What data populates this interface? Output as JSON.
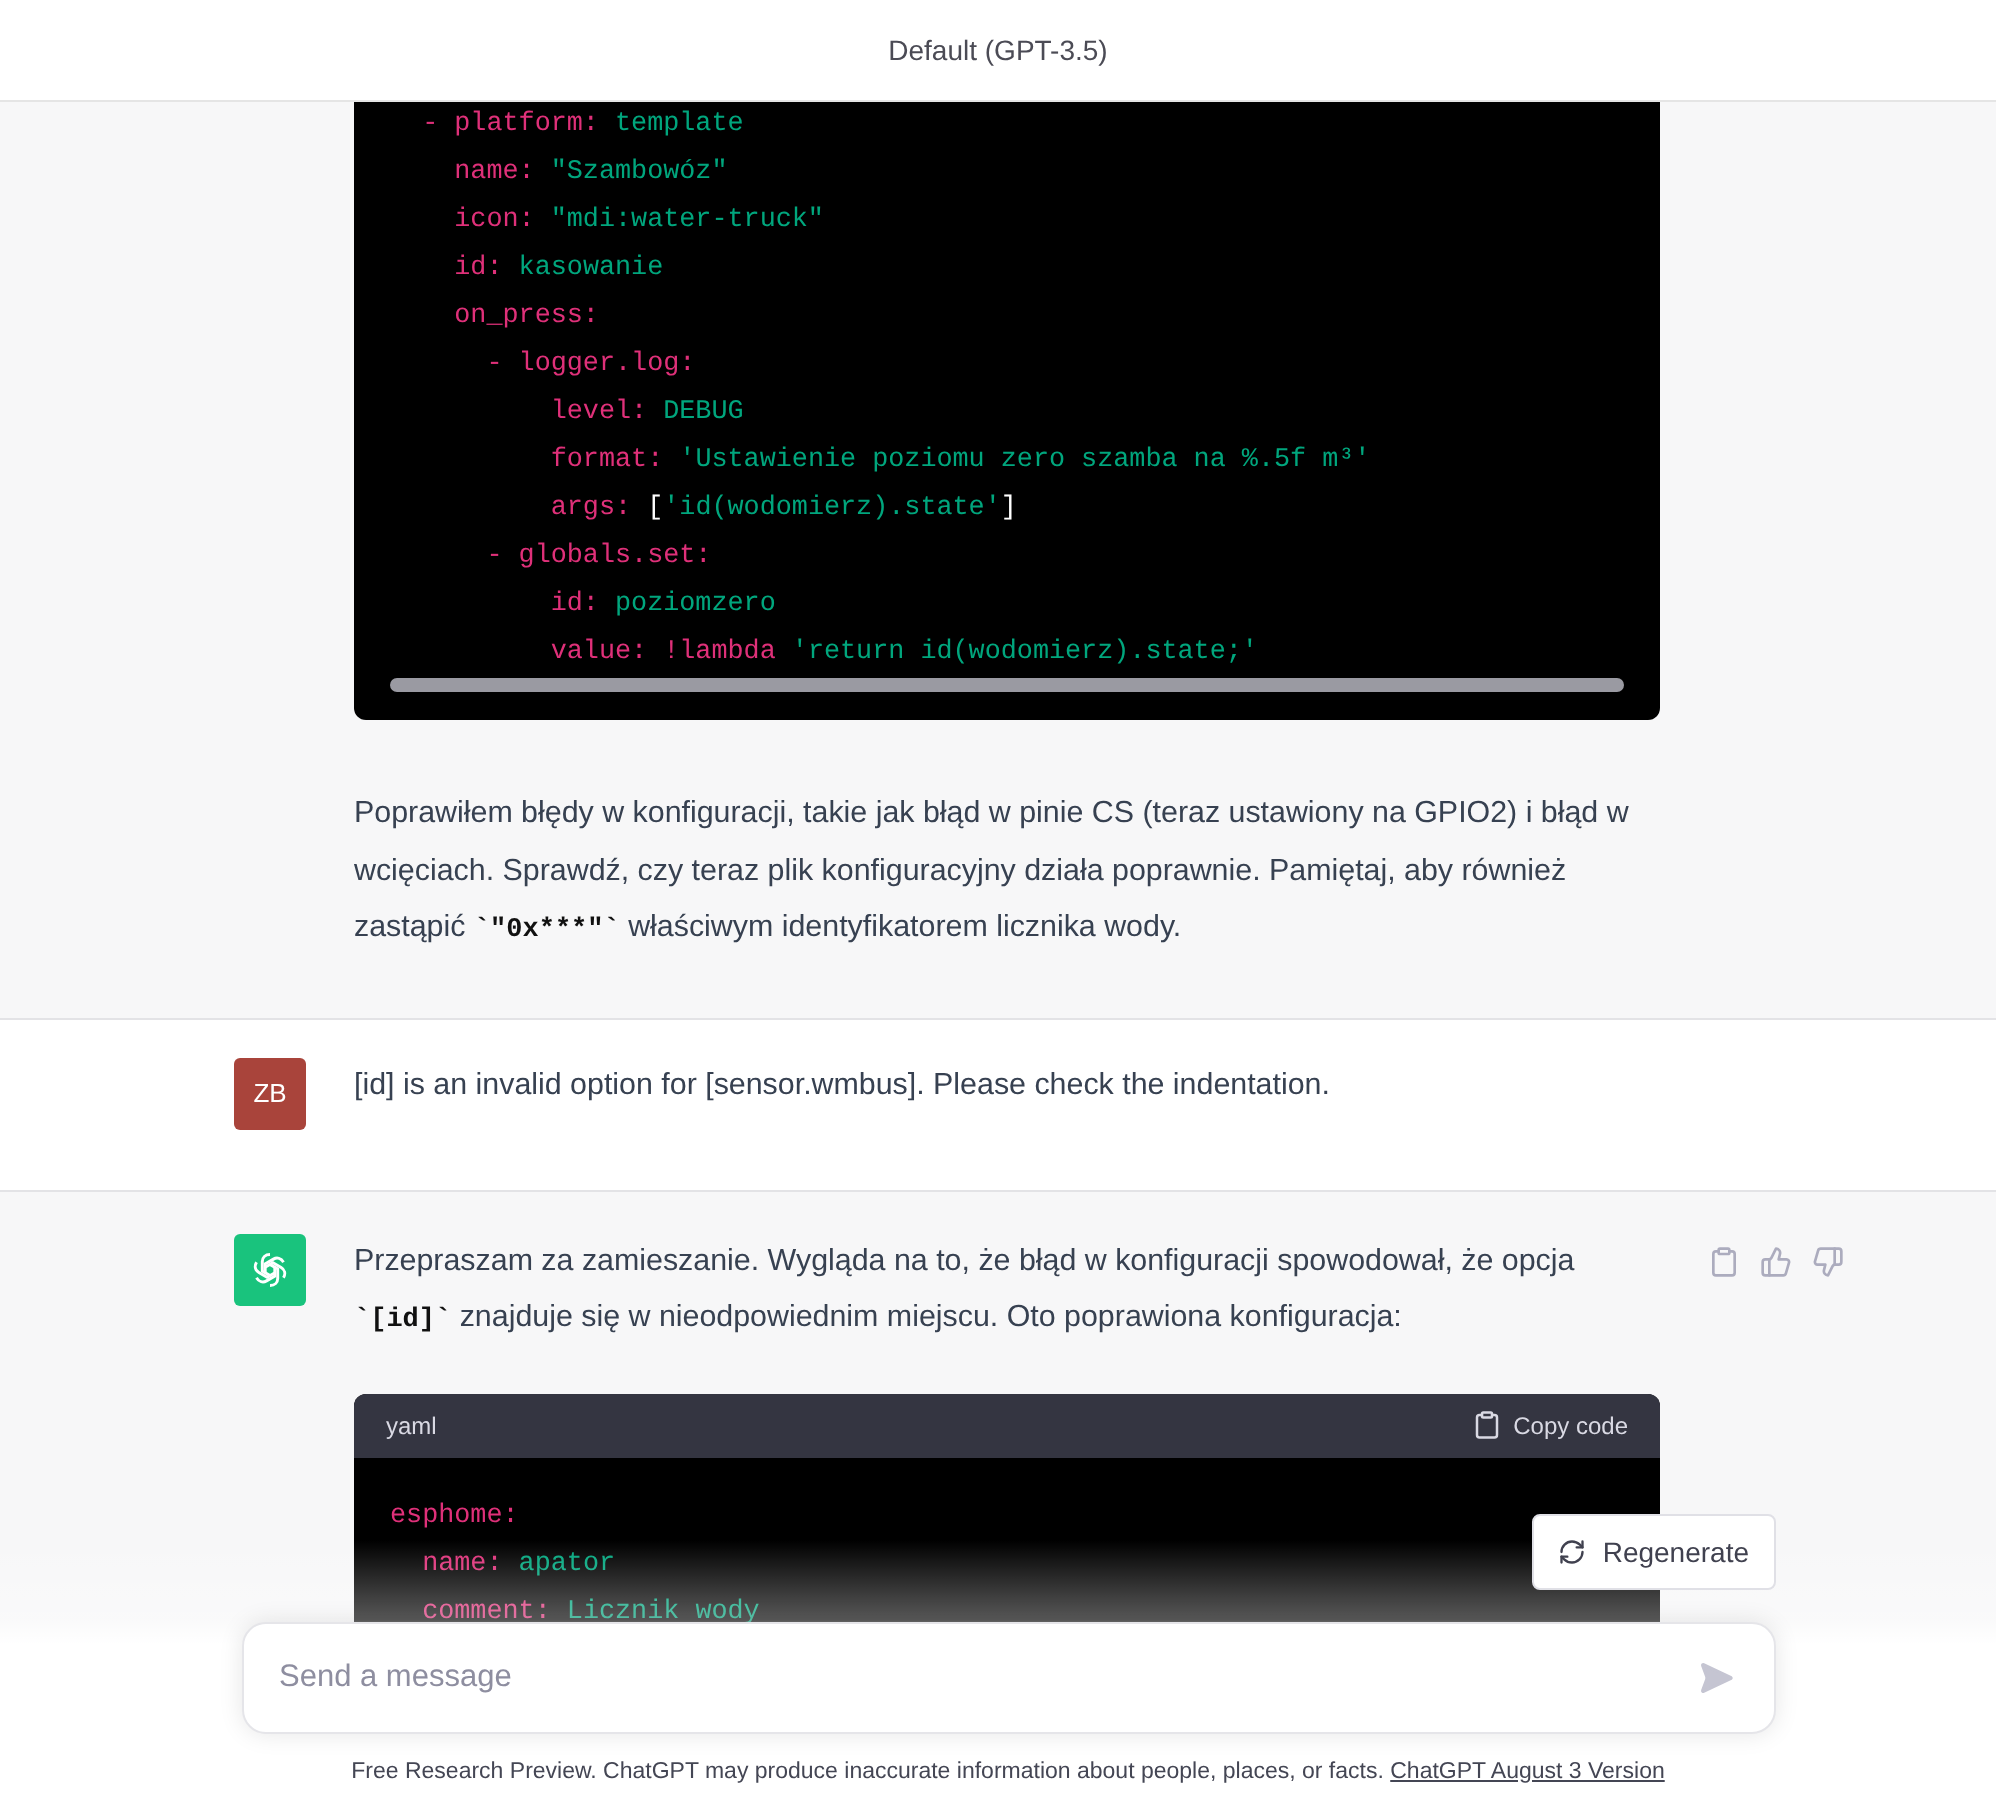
{
  "header": {
    "title": "Default (GPT-3.5)"
  },
  "messages": [
    {
      "kind": "assistant",
      "continued": true,
      "feedback_icons": false,
      "code": {
        "lines": [
          [
            {
              "text": "  - platform:",
              "kind": "key"
            },
            {
              "text": " template",
              "kind": "value"
            }
          ],
          [
            {
              "text": "    name: ",
              "kind": "key"
            },
            {
              "text": "\"Szambowóz\"",
              "kind": "value"
            }
          ],
          [
            {
              "text": "    icon: ",
              "kind": "key"
            },
            {
              "text": "\"mdi:water-truck\"",
              "kind": "value"
            }
          ],
          [
            {
              "text": "    id: ",
              "kind": "key"
            },
            {
              "text": "kasowanie",
              "kind": "value"
            }
          ],
          [
            {
              "text": "    on_press:",
              "kind": "key"
            }
          ],
          [
            {
              "text": "      - logger.log:",
              "kind": "key"
            }
          ],
          [
            {
              "text": "          level: ",
              "kind": "key"
            },
            {
              "text": "DEBUG",
              "kind": "value"
            }
          ],
          [
            {
              "text": "          format: ",
              "kind": "key"
            },
            {
              "text": "'Ustawienie poziomu zero szamba na %.5f m³'",
              "kind": "value"
            }
          ],
          [
            {
              "text": "          args: ",
              "kind": "key"
            },
            {
              "text": "[",
              "kind": "punct"
            },
            {
              "text": "'id(wodomierz).state'",
              "kind": "value"
            },
            {
              "text": "]",
              "kind": "punct"
            }
          ],
          [
            {
              "text": "      - globals.set:",
              "kind": "key"
            }
          ],
          [
            {
              "text": "          id: ",
              "kind": "key"
            },
            {
              "text": "poziomzero",
              "kind": "value"
            }
          ],
          [
            {
              "text": "          value: !lambda ",
              "kind": "key"
            },
            {
              "text": "'return id(wodomierz).state;'",
              "kind": "value"
            }
          ]
        ]
      },
      "text_after": [
        {
          "text": "Poprawiłem błędy w konfiguracji, takie jak błąd w pinie CS (teraz ustawiony na GPIO2) i błąd w wcięciach. Sprawdź, czy teraz plik konfiguracyjny działa poprawnie. Pamiętaj, aby również zastąpić ",
          "kind": "text"
        },
        {
          "text": "`\"0x***\"`",
          "kind": "code"
        },
        {
          "text": " właściwym identyfikatorem licznika wody.",
          "kind": "text"
        }
      ]
    },
    {
      "kind": "user",
      "avatar": "ZB",
      "text_before": [
        {
          "text": "[id] is an invalid option for [sensor.wmbus]. Please check the indentation.",
          "kind": "text"
        }
      ]
    },
    {
      "kind": "assistant",
      "continued": false,
      "feedback_icons": true,
      "text_before": [
        {
          "text": "Przepraszam za zamieszanie. Wygląda na to, że błąd w konfiguracji spowodował, że opcja ",
          "kind": "text"
        },
        {
          "text": "`[id]`",
          "kind": "code"
        },
        {
          "text": " znajduje się w nieodpowiednim miejscu. Oto poprawiona konfiguracja:",
          "kind": "text"
        }
      ],
      "code": {
        "language": "yaml",
        "copy_label": "Copy code",
        "lines": [
          [
            {
              "text": "esphome:",
              "kind": "key"
            }
          ],
          [
            {
              "text": "  name: ",
              "kind": "key"
            },
            {
              "text": "apator",
              "kind": "value"
            }
          ],
          [
            {
              "text": "  comment: ",
              "kind": "key"
            },
            {
              "text": "Licznik wody",
              "kind": "value"
            }
          ]
        ]
      }
    }
  ],
  "regenerate": {
    "label": "Regenerate"
  },
  "composer": {
    "placeholder": "Send a message"
  },
  "footer": {
    "text": "Free Research Preview. ChatGPT may produce inaccurate information about people, places, or facts.",
    "link": "ChatGPT August 3 Version"
  }
}
